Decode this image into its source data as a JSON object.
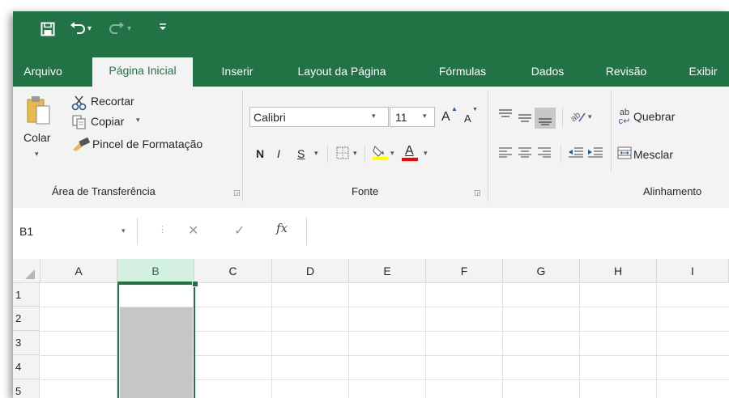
{
  "qat": {
    "save_icon": "save-icon",
    "undo_icon": "undo-icon",
    "redo_icon": "redo-icon",
    "customize_icon": "customize-qat-icon"
  },
  "tabs": [
    {
      "label": "Arquivo",
      "active": false
    },
    {
      "label": "Página Inicial",
      "active": true
    },
    {
      "label": "Inserir",
      "active": false
    },
    {
      "label": "Layout da Página",
      "active": false
    },
    {
      "label": "Fórmulas",
      "active": false
    },
    {
      "label": "Dados",
      "active": false
    },
    {
      "label": "Revisão",
      "active": false
    },
    {
      "label": "Exibir",
      "active": false
    }
  ],
  "clipboard": {
    "paste_label": "Colar",
    "cut_label": "Recortar",
    "copy_label": "Copiar",
    "format_painter_label": "Pincel de Formatação",
    "group_label": "Área de Transferência"
  },
  "font": {
    "font_name": "Calibri",
    "font_size": "11",
    "bold": "N",
    "italic": "I",
    "underline": "S",
    "grow_label": "A",
    "shrink_label": "A",
    "color_label": "A",
    "group_label": "Fonte",
    "highlight_color": "#ffff00",
    "font_color": "#ff0000"
  },
  "alignment": {
    "wrap_label": "Quebrar",
    "merge_label": "Mesclar",
    "group_label": "Alinhamento"
  },
  "formula_bar": {
    "name_box": "B1",
    "cancel_glyph": "✕",
    "enter_glyph": "✓",
    "fx_label": "fx",
    "value": ""
  },
  "sheet": {
    "columns": [
      "A",
      "B",
      "C",
      "D",
      "E",
      "F",
      "G",
      "H",
      "I"
    ],
    "rows": [
      "1",
      "2",
      "3",
      "4",
      "5"
    ],
    "selected_column": "B",
    "active_cell": "B1"
  },
  "colors": {
    "brand": "#217346",
    "ribbon_bg": "#f3f3f3",
    "selected_fill": "#c6c6c6"
  }
}
